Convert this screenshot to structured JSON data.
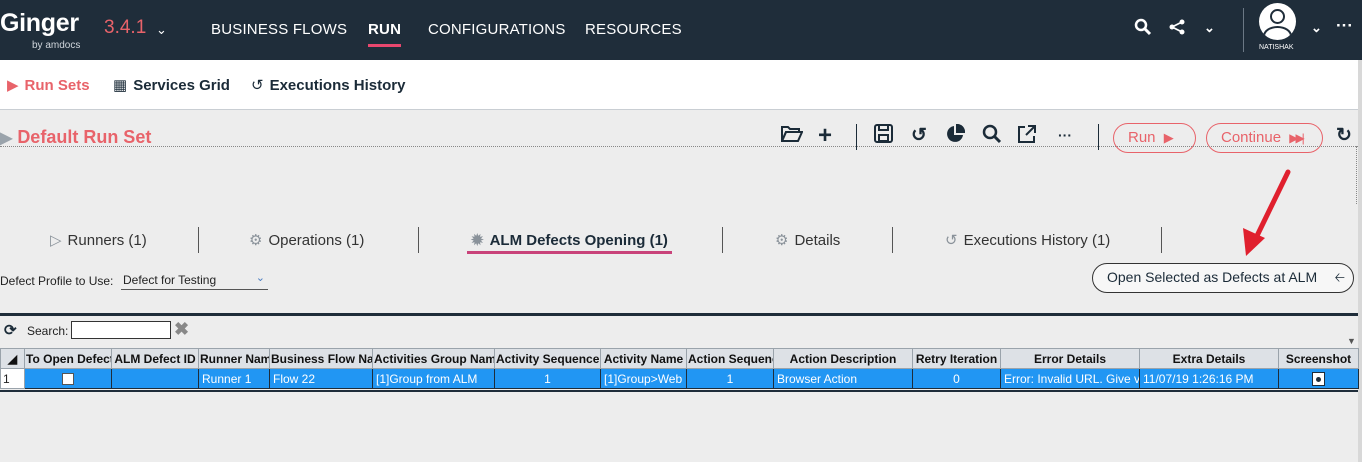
{
  "app": {
    "brand": "Ginger",
    "brand_sub": "by amdocs",
    "version": "3.4.1",
    "user": "NATISHAK"
  },
  "nav": [
    "BUSINESS FLOWS",
    "RUN",
    "CONFIGURATIONS",
    "RESOURCES"
  ],
  "nav_active": "RUN",
  "subtabs": [
    "Run Sets",
    "Services Grid",
    "Executions History"
  ],
  "runset": {
    "title": "Default Run Set",
    "run_label": "Run",
    "continue_label": "Continue"
  },
  "runset_tabs": [
    "Runners (1)",
    "Operations (1)",
    "ALM Defects Opening (1)",
    "Details",
    "Executions History (1)"
  ],
  "defects": {
    "profile_label": "Defect Profile to Use:",
    "profile_value": "Defect for Testing",
    "open_button": "Open Selected as Defects at ALM",
    "search_label": "Search:",
    "search_value": ""
  },
  "grid": {
    "columns": [
      "To Open Defect",
      "ALM Defect ID",
      "Runner Name",
      "Business Flow Name",
      "Activities Group Name",
      "Activity Sequence",
      "Activity Name",
      "Action Sequence",
      "Action Description",
      "Retry Iteration",
      "Error Details",
      "Extra Details",
      "Screenshot"
    ],
    "rows": [
      {
        "index": "1",
        "to_open": false,
        "alm_defect_id": "",
        "runner": "Runner 1",
        "business_flow": "Flow 22",
        "activities_group": "[1]Group from ALM",
        "activity_sequence": "1",
        "activity_name": "[1]Group>Web",
        "action_sequence": "1",
        "action_description": "Browser Action",
        "retry_iteration": "0",
        "error_details": "Error: Invalid URL. Give valid URL",
        "extra_details": "11/07/19 1:26:16 PM"
      }
    ]
  },
  "colors": {
    "topbar": "#1f2d3a",
    "accent": "#e8636a",
    "selected_row": "#2196f3",
    "annotation_arrow": "#e0202e"
  }
}
